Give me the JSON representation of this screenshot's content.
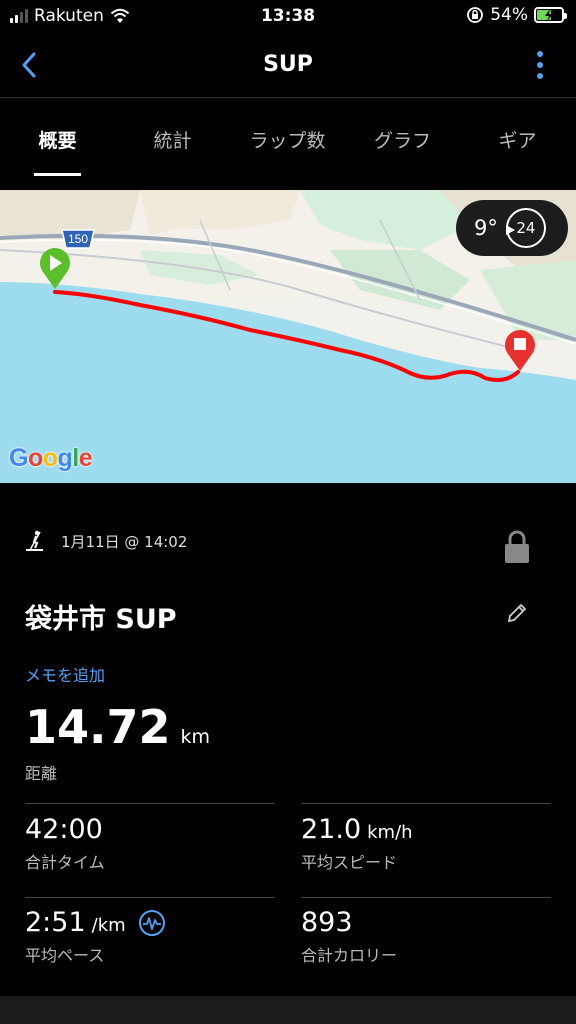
{
  "status_bar": {
    "carrier": "Rakuten",
    "time": "13:38",
    "battery_pct": "54%",
    "battery_level": 0.54,
    "icons": [
      "signal-icon",
      "wifi-icon",
      "orientation-lock-icon",
      "battery-charging-icon"
    ]
  },
  "nav": {
    "title": "SUP",
    "back_icon": "chevron-left-icon",
    "menu_icon": "more-vertical-icon"
  },
  "tabs": [
    {
      "label": "概要",
      "active": true
    },
    {
      "label": "統計",
      "active": false
    },
    {
      "label": "ラップ数",
      "active": false
    },
    {
      "label": "グラフ",
      "active": false
    },
    {
      "label": "ギア",
      "active": false
    }
  ],
  "map": {
    "road_label": "150",
    "weather": {
      "temp": "9°",
      "wind": "24"
    },
    "attribution": "Google",
    "route_color": "#ff0000",
    "start_marker_color": "#5bbf2a",
    "end_marker_color": "#e8312f"
  },
  "activity": {
    "icon": "paddleboard-icon",
    "datetime": "1月11日 @ 14:02",
    "title": "袋井市 SUP",
    "memo_link": "メモを追加",
    "distance": {
      "value": "14.72",
      "unit": "km",
      "label": "距離"
    }
  },
  "stats": {
    "total_time": {
      "value": "42:00",
      "unit": "",
      "label": "合計タイム"
    },
    "avg_speed": {
      "value": "21.0",
      "unit": "km/h",
      "label": "平均スピード"
    },
    "avg_pace": {
      "value": "2:51",
      "unit": "/km",
      "label": "平均ペース"
    },
    "calories": {
      "value": "893",
      "unit": "",
      "label": "合計カロリー"
    }
  },
  "colors": {
    "accent": "#4fa3f7",
    "background": "#000000"
  }
}
